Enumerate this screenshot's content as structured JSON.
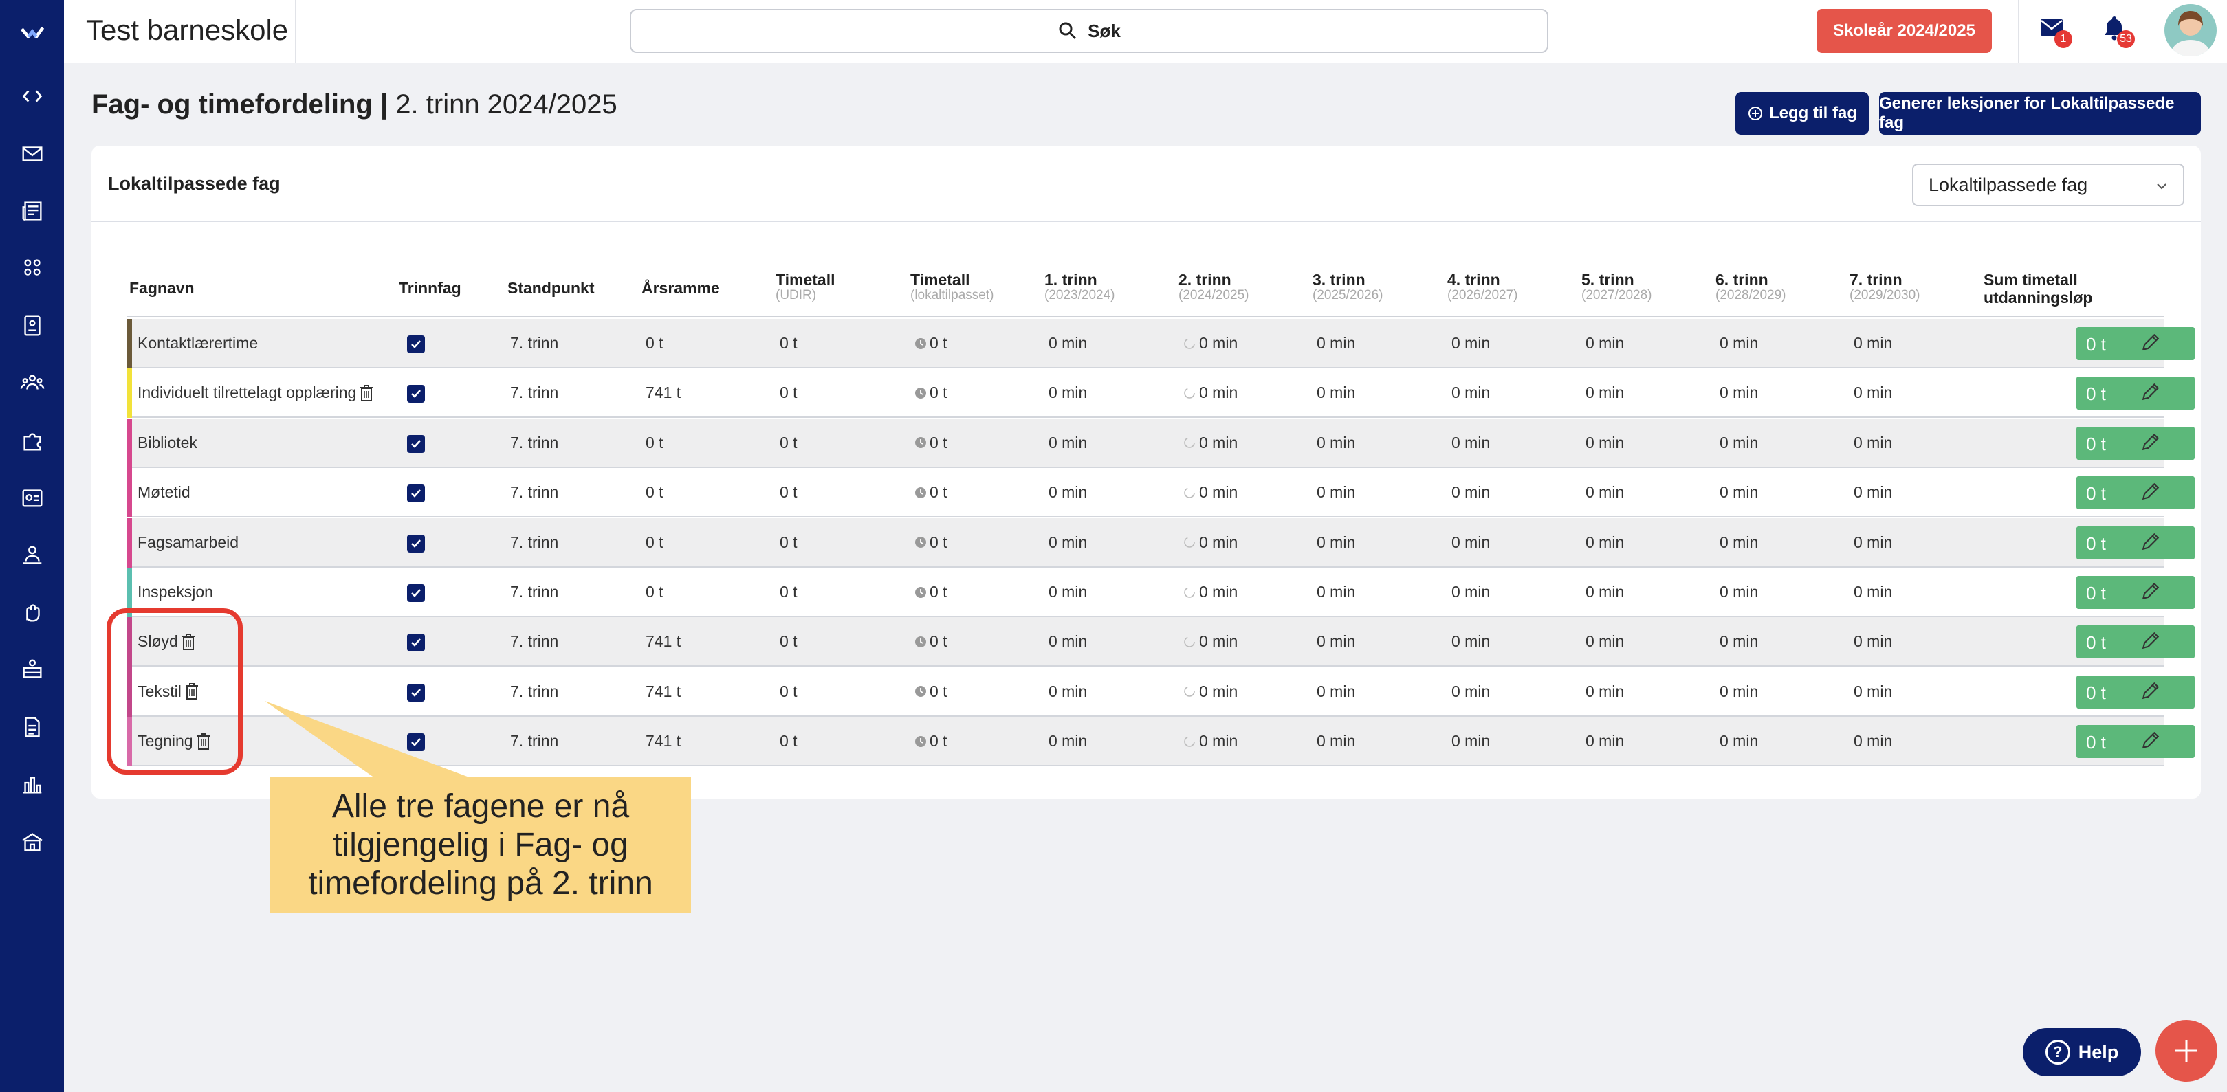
{
  "app": {
    "school_name": "Test barneskole",
    "search_label": "Søk",
    "school_year_button": "Skoleår 2024/2025",
    "mail_badge": "1",
    "notification_badge": "53"
  },
  "page": {
    "title_bold": "Fag- og timefordeling |",
    "title_rest": " 2. trinn 2024/2025",
    "add_subject_button": "Legg til fag",
    "generate_button": "Generer leksjoner for Lokaltilpassede fag"
  },
  "card": {
    "title": "Lokaltilpassede fag",
    "filter_value": "Lokaltilpassede fag"
  },
  "table": {
    "headers": {
      "fagnavn": "Fagnavn",
      "trinnfag": "Trinnfag",
      "standpunkt": "Standpunkt",
      "arsramme": "Årsramme",
      "timetall_udir": "Timetall",
      "timetall_udir_sub": "(UDIR)",
      "timetall_lokal": "Timetall",
      "timetall_lokal_sub": "(lokaltilpasset)",
      "t1": "1. trinn",
      "t1_sub": "(2023/2024)",
      "t2": "2. trinn",
      "t2_sub": "(2024/2025)",
      "t3": "3. trinn",
      "t3_sub": "(2025/2026)",
      "t4": "4. trinn",
      "t4_sub": "(2026/2027)",
      "t5": "5. trinn",
      "t5_sub": "(2027/2028)",
      "t6": "6. trinn",
      "t6_sub": "(2028/2029)",
      "t7": "7. trinn",
      "t7_sub": "(2029/2030)",
      "sum": "Sum timetall",
      "sum2": "utdanningsløp"
    },
    "rows": [
      {
        "name": "Kontaktlærertime",
        "color": "#6b5a3a",
        "trash": false,
        "standpunkt": "7. trinn",
        "arsramme": "0 t",
        "udir": "0 t",
        "lokal": "0 t",
        "t1": "0 min",
        "t2": "0 min",
        "t3": "0 min",
        "t4": "0 min",
        "t5": "0 min",
        "t6": "0 min",
        "t7": "0 min",
        "sum": "0 t"
      },
      {
        "name": "Individuelt tilrettelagt opplæring",
        "color": "#f2e23a",
        "trash": true,
        "standpunkt": "7. trinn",
        "arsramme": "741 t",
        "udir": "0 t",
        "lokal": "0 t",
        "t1": "0 min",
        "t2": "0 min",
        "t3": "0 min",
        "t4": "0 min",
        "t5": "0 min",
        "t6": "0 min",
        "t7": "0 min",
        "sum": "0 t"
      },
      {
        "name": "Bibliotek",
        "color": "#d6488e",
        "trash": false,
        "standpunkt": "7. trinn",
        "arsramme": "0 t",
        "udir": "0 t",
        "lokal": "0 t",
        "t1": "0 min",
        "t2": "0 min",
        "t3": "0 min",
        "t4": "0 min",
        "t5": "0 min",
        "t6": "0 min",
        "t7": "0 min",
        "sum": "0 t"
      },
      {
        "name": "Møtetid",
        "color": "#d6488e",
        "trash": false,
        "standpunkt": "7. trinn",
        "arsramme": "0 t",
        "udir": "0 t",
        "lokal": "0 t",
        "t1": "0 min",
        "t2": "0 min",
        "t3": "0 min",
        "t4": "0 min",
        "t5": "0 min",
        "t6": "0 min",
        "t7": "0 min",
        "sum": "0 t"
      },
      {
        "name": "Fagsamarbeid",
        "color": "#d6488e",
        "trash": false,
        "standpunkt": "7. trinn",
        "arsramme": "0 t",
        "udir": "0 t",
        "lokal": "0 t",
        "t1": "0 min",
        "t2": "0 min",
        "t3": "0 min",
        "t4": "0 min",
        "t5": "0 min",
        "t6": "0 min",
        "t7": "0 min",
        "sum": "0 t"
      },
      {
        "name": "Inspeksjon",
        "color": "#5bbfb0",
        "trash": false,
        "standpunkt": "7. trinn",
        "arsramme": "0 t",
        "udir": "0 t",
        "lokal": "0 t",
        "t1": "0 min",
        "t2": "0 min",
        "t3": "0 min",
        "t4": "0 min",
        "t5": "0 min",
        "t6": "0 min",
        "t7": "0 min",
        "sum": "0 t"
      },
      {
        "name": "Sløyd",
        "color": "#c2478a",
        "trash": true,
        "standpunkt": "7. trinn",
        "arsramme": "741 t",
        "udir": "0 t",
        "lokal": "0 t",
        "t1": "0 min",
        "t2": "0 min",
        "t3": "0 min",
        "t4": "0 min",
        "t5": "0 min",
        "t6": "0 min",
        "t7": "0 min",
        "sum": "0 t"
      },
      {
        "name": "Tekstil",
        "color": "#c2478a",
        "trash": true,
        "standpunkt": "7. trinn",
        "arsramme": "741 t",
        "udir": "0 t",
        "lokal": "0 t",
        "t1": "0 min",
        "t2": "0 min",
        "t3": "0 min",
        "t4": "0 min",
        "t5": "0 min",
        "t6": "0 min",
        "t7": "0 min",
        "sum": "0 t"
      },
      {
        "name": "Tegning",
        "color": "#d86aa8",
        "trash": true,
        "standpunkt": "7. trinn",
        "arsramme": "741 t",
        "udir": "0 t",
        "lokal": "0 t",
        "t1": "0 min",
        "t2": "0 min",
        "t3": "0 min",
        "t4": "0 min",
        "t5": "0 min",
        "t6": "0 min",
        "t7": "0 min",
        "sum": "0 t"
      }
    ]
  },
  "annotation": {
    "text": "Alle tre fagene er nå tilgjengelig i Fag- og timefordeling på 2. trinn"
  },
  "help": {
    "label": "Help"
  },
  "colors": {
    "sidebar": "#0b1f6b",
    "accent_red": "#e5554a",
    "sum_green": "#5cb87a",
    "callout": "#fad785"
  }
}
